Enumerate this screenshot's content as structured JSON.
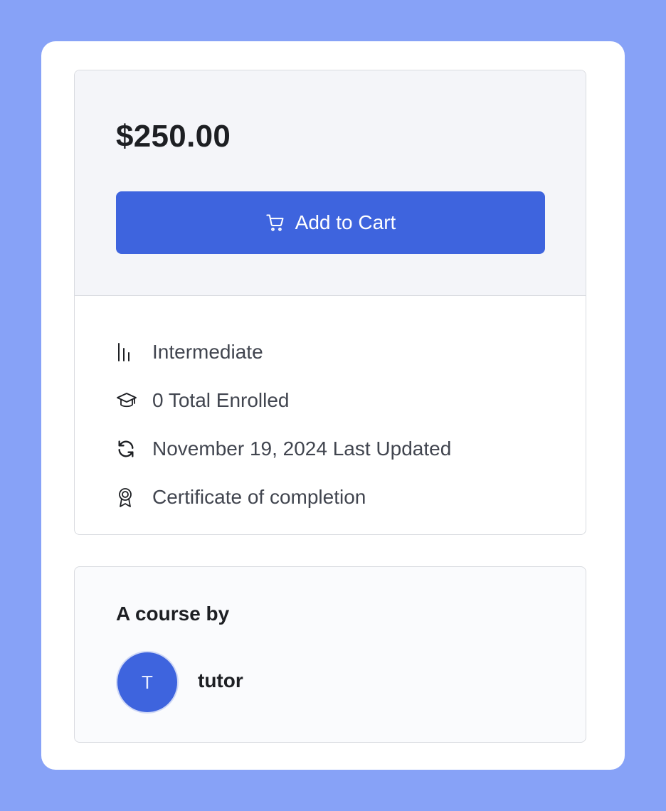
{
  "pricing": {
    "price": "$250.00",
    "add_to_cart_label": "Add to Cart"
  },
  "meta": [
    {
      "icon": "level-icon",
      "label": "Intermediate"
    },
    {
      "icon": "graduation-cap-icon",
      "label": "0 Total Enrolled"
    },
    {
      "icon": "refresh-icon",
      "label": "November 19, 2024 Last Updated"
    },
    {
      "icon": "certificate-icon",
      "label": "Certificate of completion"
    }
  ],
  "author": {
    "heading": "A course by",
    "avatar_initial": "T",
    "name": "tutor"
  },
  "colors": {
    "background": "#87a2f7",
    "primary": "#3e64de",
    "panel": "#f4f5f9"
  }
}
